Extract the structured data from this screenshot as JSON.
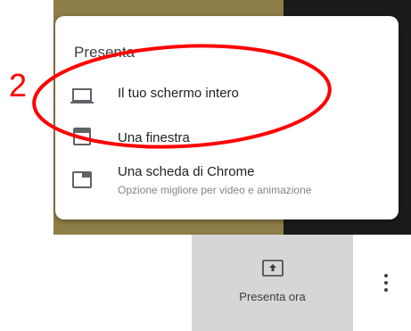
{
  "menu": {
    "title": "Presenta",
    "items": [
      {
        "label": "Il tuo schermo intero",
        "icon": "laptop-icon"
      },
      {
        "label": "Una finestra",
        "icon": "window-icon"
      },
      {
        "label": "Una scheda di Chrome",
        "sublabel": "Opzione migliore per video e animazione",
        "icon": "chrome-tab-icon"
      }
    ]
  },
  "toolbar": {
    "present_label": "Presenta ora",
    "present_icon": "present-to-all-icon",
    "more_icon": "more-vert-icon"
  },
  "annotation": {
    "step_number": "2",
    "color": "#ff0000"
  },
  "colors": {
    "background_left": "#8d7d47",
    "background_right": "#1b1b1b",
    "present_button": "#d6d6d6"
  }
}
